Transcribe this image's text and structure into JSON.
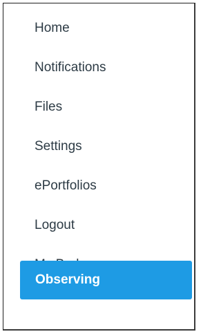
{
  "nav": {
    "items": [
      {
        "label": "Home"
      },
      {
        "label": "Notifications"
      },
      {
        "label": "Files"
      },
      {
        "label": "Settings"
      },
      {
        "label": "ePortfolios"
      },
      {
        "label": "Logout"
      },
      {
        "label": "My Badges"
      },
      {
        "label": "Observing",
        "active": true
      }
    ]
  },
  "colors": {
    "active_bg": "#1e9be4",
    "active_text": "#ffffff",
    "text": "#2d3b45",
    "border": "#1f1f1f"
  }
}
